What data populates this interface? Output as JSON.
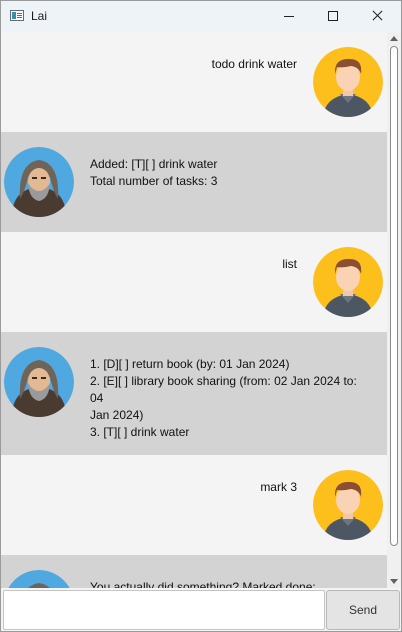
{
  "window": {
    "title": "Lai",
    "icon": "app-window-icon",
    "controls": [
      "minimize-icon",
      "maximize-icon",
      "close-icon"
    ]
  },
  "messages": [
    {
      "sender": "user",
      "avatar": "user-avatar",
      "lines": [
        "todo drink water"
      ]
    },
    {
      "sender": "bot",
      "avatar": "bot-avatar",
      "lines": [
        "Added: [T][ ] drink water",
        "Total number of tasks: 3"
      ]
    },
    {
      "sender": "user",
      "avatar": "user-avatar",
      "lines": [
        "list"
      ]
    },
    {
      "sender": "bot",
      "avatar": "bot-avatar",
      "lines": [
        "1. [D][ ] return book (by: 01 Jan 2024)",
        "2. [E][ ] library book sharing (from: 02 Jan 2024 to: 04",
        "Jan 2024)",
        "3. [T][ ] drink water"
      ]
    },
    {
      "sender": "user",
      "avatar": "user-avatar",
      "lines": [
        "mark 3"
      ]
    },
    {
      "sender": "bot",
      "avatar": "bot-avatar",
      "lines": [
        "You actually did something? Marked done:"
      ]
    }
  ],
  "input": {
    "value": "",
    "placeholder": ""
  },
  "send_label": "Send",
  "colors": {
    "user_bubble_bg": "#f4f4f4",
    "bot_bubble_bg": "#d3d3d3",
    "user_avatar_ring": "#fdbf1c",
    "bot_avatar_ring": "#4fa8df"
  }
}
